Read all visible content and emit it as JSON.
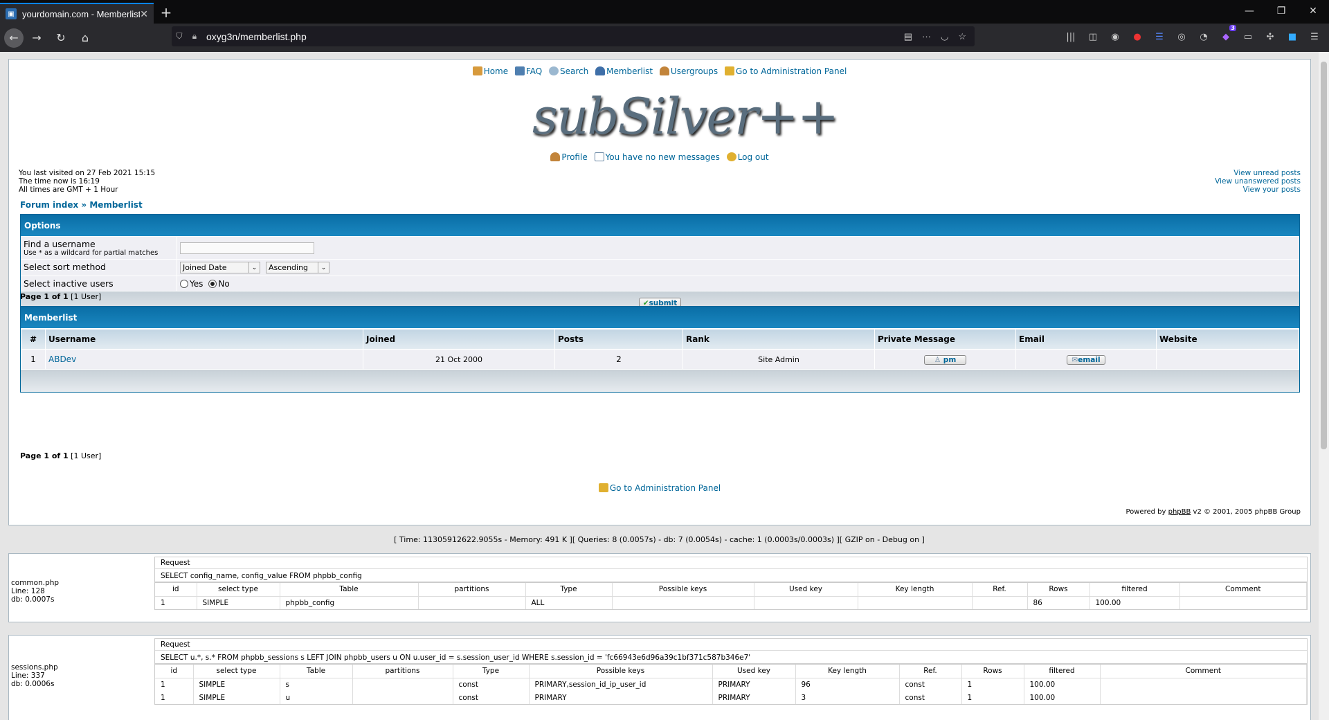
{
  "browser": {
    "tab_title": "yourdomain.com - Memberlist",
    "url": "oxyg3n/memberlist.php",
    "ext_badge": "3"
  },
  "nav": {
    "home": "Home",
    "faq": "FAQ",
    "search": "Search",
    "memberlist": "Memberlist",
    "usergroups": "Usergroups",
    "admin": "Go to Administration Panel"
  },
  "logo_text": "subSilver++",
  "usernav": {
    "profile": "Profile",
    "messages": "You have no new messages",
    "logout": "Log out"
  },
  "visit": {
    "last": "You last visited on 27 Feb 2021 15:15",
    "now": "The time now is 16:19",
    "tz": "All times are GMT + 1 Hour"
  },
  "view_links": {
    "unread": "View unread posts",
    "unanswered": "View unanswered posts",
    "yours": "View your posts"
  },
  "breadcrumb": {
    "index": "Forum index",
    "sep": " » ",
    "current": "Memberlist"
  },
  "options": {
    "title": "Options",
    "find_label": "Find a username",
    "find_hint": "Use * as a wildcard for partial matches",
    "find_value": "",
    "sort_label": "Select sort method",
    "sort_value": "Joined Date",
    "order_value": "Ascending",
    "inactive_label": "Select inactive users",
    "yes": "Yes",
    "no": "No",
    "submit": "submit"
  },
  "pageinfo": {
    "page": "Page 1 of 1",
    "users": "[1 User]"
  },
  "memberlist": {
    "title": "Memberlist",
    "headers": [
      "#",
      "Username",
      "Joined",
      "Posts",
      "Rank",
      "Private Message",
      "Email",
      "Website"
    ],
    "rows": [
      {
        "num": "1",
        "username": "ABDev",
        "joined": "21 Oct 2000",
        "posts": "2",
        "rank": "Site Admin",
        "pm": "pm",
        "email": "email",
        "website": ""
      }
    ]
  },
  "footer": {
    "admin": "Go to Administration Panel",
    "powered_pre": "Powered by ",
    "powered_link": "phpBB",
    "powered_post": " v2 © 2001, 2005 phpBB Group"
  },
  "debug": {
    "stats": "[ Time: 11305912622.9055s - Memory: 491 K ][ Queries: 8 (0.0057s) - db: 7 (0.0054s) - cache: 1 (0.0003s/0.0003s) ][ GZIP on - Debug on ]",
    "request_label": "Request",
    "columns": [
      "id",
      "select type",
      "Table",
      "partitions",
      "Type",
      "Possible keys",
      "Used key",
      "Key length",
      "Ref.",
      "Rows",
      "filtered",
      "Comment"
    ],
    "blocks": [
      {
        "file": "common.php",
        "line": "Line: 128",
        "db": "db: 0.0007s",
        "sql": "SELECT config_name, config_value FROM phpbb_config",
        "rows": [
          [
            "1",
            "SIMPLE",
            "phpbb_config",
            "",
            "ALL",
            "",
            "",
            "",
            "",
            "86",
            "100.00",
            ""
          ]
        ]
      },
      {
        "file": "sessions.php",
        "line": "Line: 337",
        "db": "db: 0.0006s",
        "sql": "SELECT u.*, s.* FROM phpbb_sessions s LEFT JOIN phpbb_users u ON u.user_id = s.session_user_id WHERE s.session_id = 'fc66943e6d96a39c1bf371c587b346e7'",
        "rows": [
          [
            "1",
            "SIMPLE",
            "s",
            "",
            "const",
            "PRIMARY,session_id_ip_user_id",
            "PRIMARY",
            "96",
            "const",
            "1",
            "100.00",
            ""
          ],
          [
            "1",
            "SIMPLE",
            "u",
            "",
            "const",
            "PRIMARY",
            "PRIMARY",
            "3",
            "const",
            "1",
            "100.00",
            ""
          ]
        ]
      }
    ]
  }
}
